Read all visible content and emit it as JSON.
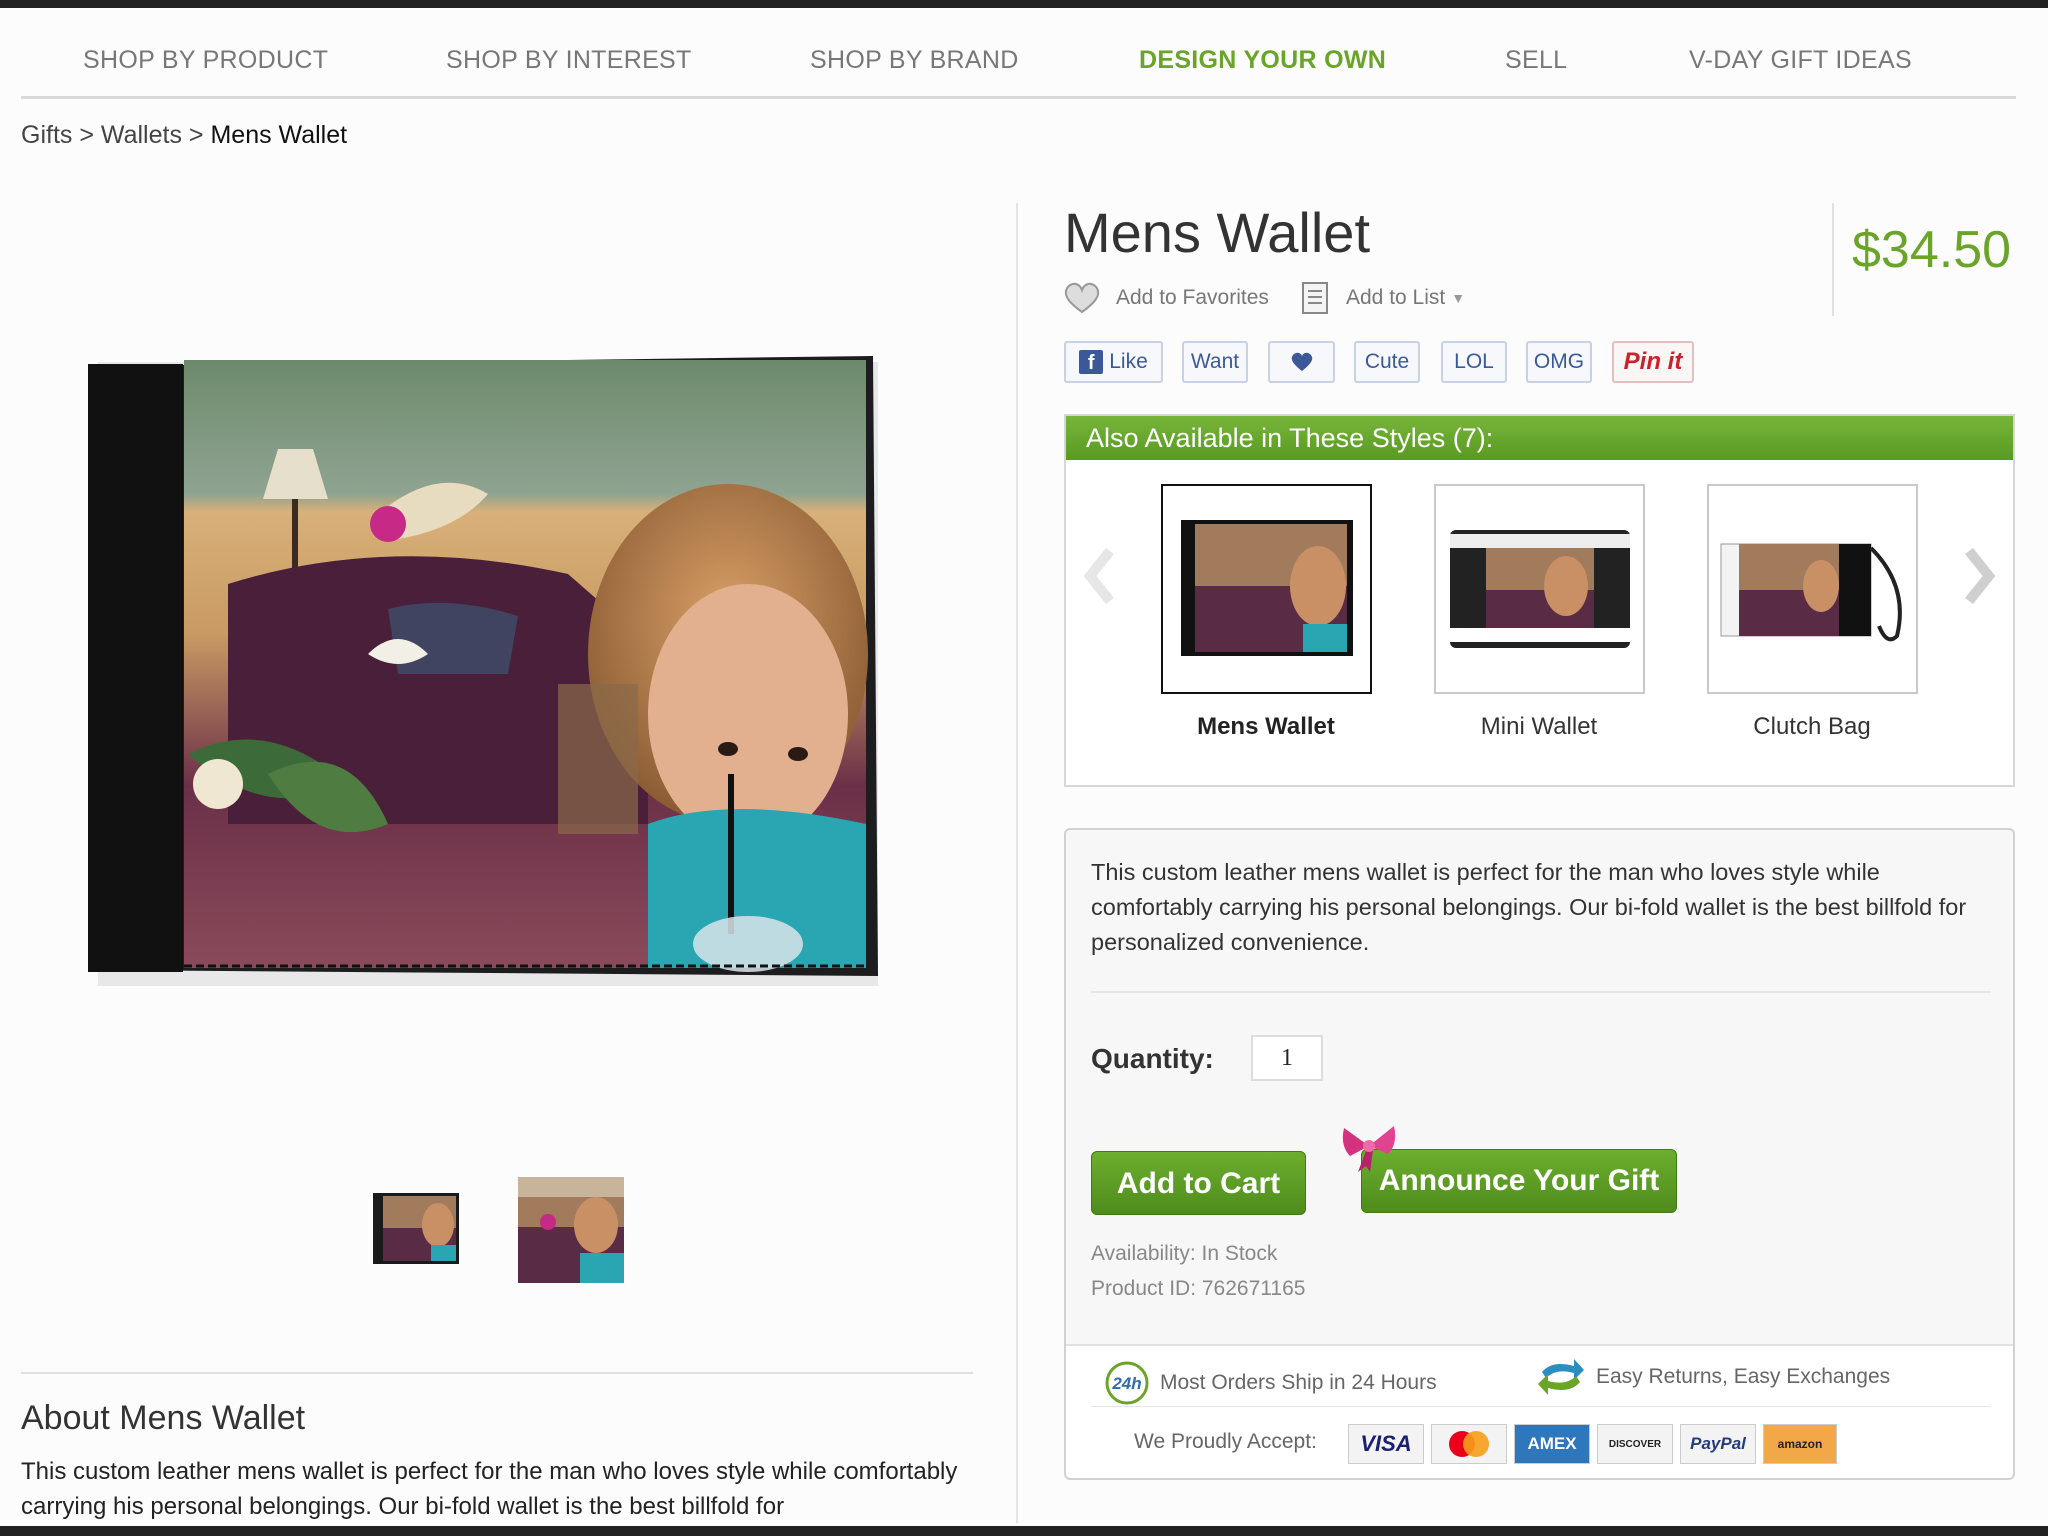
{
  "nav": {
    "items": [
      {
        "label": "SHOP BY PRODUCT"
      },
      {
        "label": "SHOP BY INTEREST"
      },
      {
        "label": "SHOP BY BRAND"
      },
      {
        "label": "DESIGN YOUR OWN"
      },
      {
        "label": "SELL"
      },
      {
        "label": "V-DAY GIFT IDEAS"
      }
    ],
    "active": "DESIGN YOUR OWN",
    "active_color": "#6aa52a"
  },
  "breadcrumb": {
    "items": [
      "Gifts",
      "Wallets"
    ],
    "separator": ">",
    "current": "Mens Wallet"
  },
  "product": {
    "title": "Mens Wallet",
    "price": "$34.50",
    "price_color": "#6aa52a",
    "favorites_label": "Add to Favorites",
    "favorites_icon": "heart-icon",
    "list_label": "Add to List",
    "list_icon": "document-icon"
  },
  "social": {
    "like": "Like",
    "want": "Want",
    "love_icon": "heart-icon",
    "cute": "Cute",
    "lol": "LOL",
    "omg": "OMG",
    "pin": "Pin it"
  },
  "styles": {
    "header": "Also Available in These Styles (7):",
    "items": [
      {
        "label": "Mens Wallet",
        "selected": true
      },
      {
        "label": "Mini Wallet",
        "selected": false
      },
      {
        "label": "Clutch Bag",
        "selected": false
      }
    ],
    "prev_icon": "chevron-left-icon",
    "next_icon": "chevron-right-icon"
  },
  "buy": {
    "description": "This custom leather mens wallet is perfect for the man who loves style while comfortably carrying his personal belongings. Our bi-fold wallet is the best billfold for personalized convenience.",
    "quantity_label": "Quantity:",
    "quantity_value": "1",
    "add_to_cart": "Add to Cart",
    "announce_gift": "Announce Your Gift",
    "availability": "Availability: In Stock",
    "product_id": "Product ID: 762671165",
    "button_color": "#5fa027"
  },
  "shipping": {
    "ship_text": "Most Orders Ship in 24 Hours",
    "ship_icon": "24h-icon",
    "ship_icon_text": "24h",
    "returns_text": "Easy Returns, Easy Exchanges",
    "returns_icon": "exchange-arrows-icon",
    "accept_label": "We Proudly Accept:",
    "cards": [
      "VISA",
      "MC",
      "AMEX",
      "DISCOVER",
      "PayPal",
      "amazon"
    ]
  },
  "about": {
    "title": "About Mens Wallet",
    "text": "This custom leather mens wallet is perfect for the man who loves style while comfortably carrying his personal belongings. Our bi-fold wallet is the best billfold for"
  }
}
